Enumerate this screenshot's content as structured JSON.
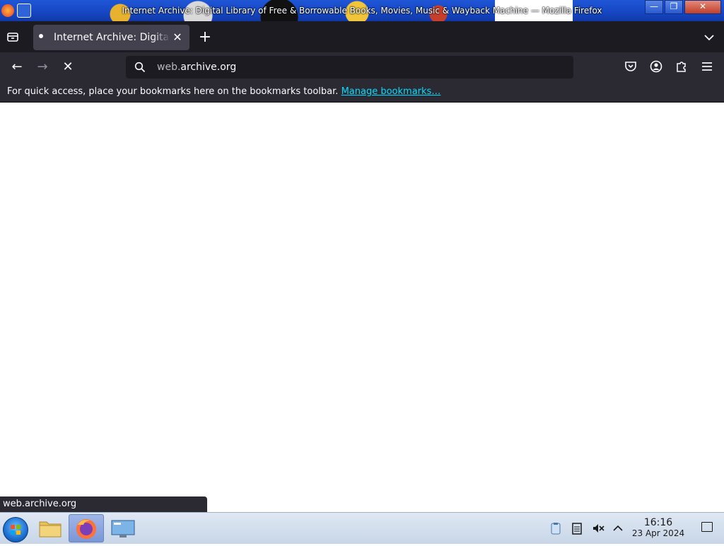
{
  "window": {
    "title": "Internet Archive: Digital Library of Free & Borrowable Books, Movies, Music & Wayback Machine — Mozilla Firefox",
    "minimize_label": "—",
    "maximize_label": "❐",
    "close_label": "✕"
  },
  "tabs": {
    "active_tab_label": "Internet Archive: Digital Library of Free & Borrowable Books, Movies, Music & Wayback Machine",
    "close_symbol": "✕",
    "new_tab_symbol": "+"
  },
  "navbar": {
    "back_symbol": "←",
    "forward_symbol": "→",
    "stop_symbol": "✕",
    "url_host_prefix": "web.",
    "url_domain": "archive.org"
  },
  "bookmarks_toolbar": {
    "text": "For quick access, place your bookmarks here on the bookmarks toolbar.",
    "link_label": "Manage bookmarks…"
  },
  "status_panel": {
    "text": "web.archive.org"
  },
  "taskbar": {
    "time": "16:16",
    "date": "23 Apr 2024"
  },
  "colors": {
    "tab_strip_bg": "#1c1b22",
    "navbar_bg": "#2b2a33",
    "link_color": "#00ddff",
    "titlebar_blue": "#1646c2"
  }
}
